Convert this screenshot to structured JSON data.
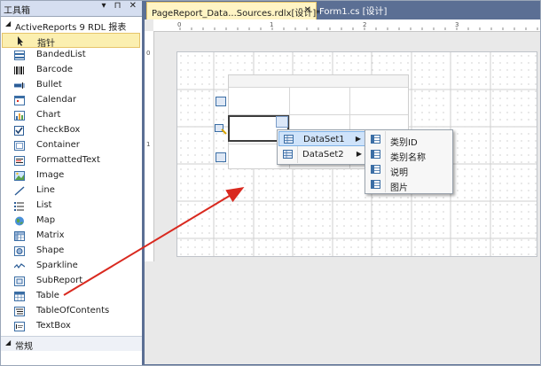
{
  "toolbox": {
    "title": "工具箱",
    "controls": "▾ ⊓ ✕",
    "group": "ActiveReports 9 RDL 报表",
    "footer_group": "常规",
    "items": [
      {
        "label": "指针",
        "icon": "pointer-icon"
      },
      {
        "label": "BandedList",
        "icon": "bandedlist-icon"
      },
      {
        "label": "Barcode",
        "icon": "barcode-icon"
      },
      {
        "label": "Bullet",
        "icon": "bullet-icon"
      },
      {
        "label": "Calendar",
        "icon": "calendar-icon"
      },
      {
        "label": "Chart",
        "icon": "chart-icon"
      },
      {
        "label": "CheckBox",
        "icon": "checkbox-icon"
      },
      {
        "label": "Container",
        "icon": "container-icon"
      },
      {
        "label": "FormattedText",
        "icon": "formattedtext-icon"
      },
      {
        "label": "Image",
        "icon": "image-icon"
      },
      {
        "label": "Line",
        "icon": "line-icon"
      },
      {
        "label": "List",
        "icon": "list-icon"
      },
      {
        "label": "Map",
        "icon": "map-icon"
      },
      {
        "label": "Matrix",
        "icon": "matrix-icon"
      },
      {
        "label": "Shape",
        "icon": "shape-icon"
      },
      {
        "label": "Sparkline",
        "icon": "sparkline-icon"
      },
      {
        "label": "SubReport",
        "icon": "subreport-icon"
      },
      {
        "label": "Table",
        "icon": "table-icon"
      },
      {
        "label": "TableOfContents",
        "icon": "tableofcontents-icon"
      },
      {
        "label": "TextBox",
        "icon": "textbox-icon"
      }
    ]
  },
  "tabs": {
    "active": "PageReport_Data...Sources.rdlx[设计]*",
    "close": "✕",
    "inactive": "Form1.cs [设计]"
  },
  "ruler": {
    "h_marks": [
      "0",
      "1",
      "2",
      "3"
    ],
    "v_marks": [
      "0",
      "1"
    ]
  },
  "context_menu": {
    "items": [
      {
        "label": "DataSet1",
        "highlighted": true
      },
      {
        "label": "DataSet2",
        "highlighted": false
      }
    ],
    "submenu": [
      "类别ID",
      "类别名称",
      "说明",
      "图片"
    ]
  },
  "colors": {
    "accent": "#d9291f",
    "selection": "#fbefb0",
    "chrome": "#5b6f94"
  }
}
